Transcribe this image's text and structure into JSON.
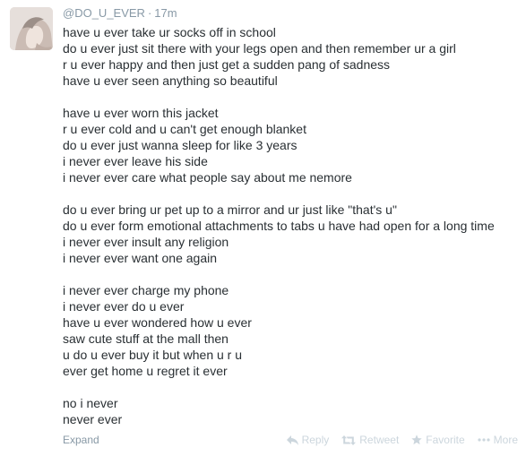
{
  "tweet": {
    "handle": "@DO_U_EVER",
    "separator": "·",
    "time": "17m",
    "paragraphs": [
      [
        "have u ever take ur socks off in school",
        "do u ever just sit there with your legs open and then remember ur a girl",
        "r u ever happy and then just get a sudden pang of sadness",
        "have u ever seen anything so beautiful"
      ],
      [
        "have u ever worn this jacket",
        "r u ever cold and u can't get enough blanket",
        "do u ever just wanna sleep for like 3 years",
        "i never ever leave his side",
        "i never ever care what people say about me nemore"
      ],
      [
        "do u ever bring ur pet up to a mirror and ur just like \"that's u\"",
        "do u ever form emotional attachments to tabs u have had open for a long time",
        "i never ever insult any religion",
        "i never ever want one again"
      ],
      [
        "i never ever charge my phone",
        "i never ever do u ever",
        "have u ever wondered how u ever",
        "saw cute stuff at the mall then",
        "u do u ever buy it but when u r u",
        "ever get home u regret it ever"
      ],
      [
        "no i never",
        "never ever"
      ]
    ]
  },
  "footer": {
    "expand_label": "Expand",
    "reply_label": "Reply",
    "retweet_label": "Retweet",
    "favorite_label": "Favorite",
    "more_label": "More"
  },
  "icons": {
    "reply": "reply-icon",
    "retweet": "retweet-icon",
    "favorite": "star-icon",
    "more": "more-dots-icon"
  },
  "colors": {
    "text": "#292f33",
    "meta": "#8899a6",
    "action": "#ccd6dd"
  }
}
